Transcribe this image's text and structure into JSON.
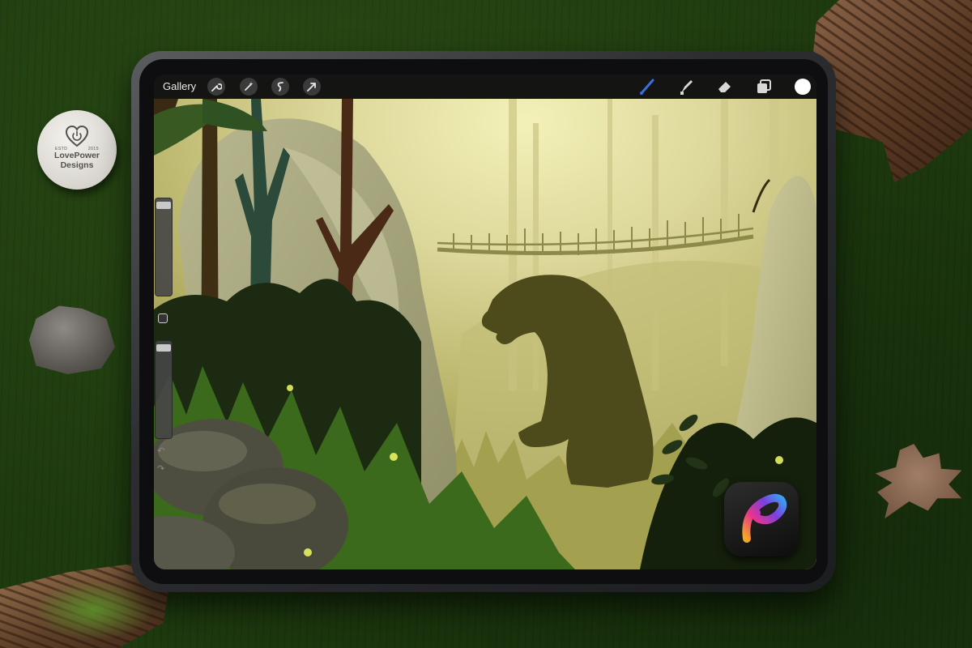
{
  "toolbar": {
    "gallery_label": "Gallery",
    "icons_left": [
      "wrench-icon",
      "magic-wand-icon",
      "selection-icon",
      "move-arrow-icon"
    ],
    "icons_right": [
      "brush-icon",
      "smudge-icon",
      "eraser-icon",
      "layers-icon"
    ],
    "brush_active_color": "#3b6fe0",
    "current_color": "#ffffff"
  },
  "sidebar": {
    "brush_size_level": 0.02,
    "opacity_level": 0.02,
    "undo_symbol": "↶",
    "redo_symbol": "↷"
  },
  "badge": {
    "name_line1": "LovePower",
    "name_line2": "Designs",
    "est_left": "ESTD",
    "est_right": "2015"
  },
  "colors": {
    "desk": "#1e3a0f",
    "sky_glow": "#f3f1b8",
    "forest_mid": "#c9c483",
    "bear_silhouette": "#4d4a1c",
    "foliage_dark": "#1c2a12"
  }
}
